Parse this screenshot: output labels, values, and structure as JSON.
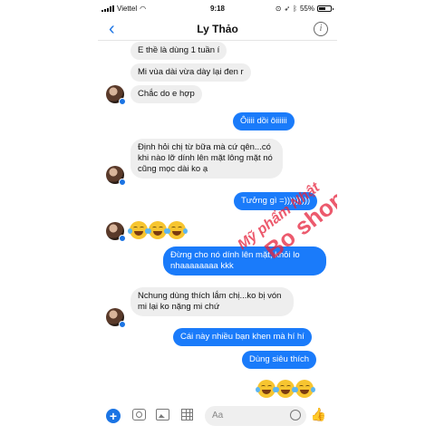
{
  "status_bar": {
    "carrier": "Viettel",
    "time": "9:18",
    "battery": "55%",
    "battery_level": 0.55
  },
  "header": {
    "title": "Ly Thảo",
    "back_icon": "chevron-left-icon",
    "info_icon": "info-icon"
  },
  "messages": [
    {
      "dir": "in",
      "text": "E thề là dùng 1 tuần í"
    },
    {
      "dir": "in",
      "text": "Mi vùa dài vừa dày lại đen r"
    },
    {
      "dir": "in",
      "text": "Chắc do e hợp"
    },
    {
      "dir": "out",
      "text": "Ôiiii dồi ôiiiiii"
    },
    {
      "dir": "in",
      "text": "Định hỏi chị từ bữa mà cứ qên...có khi nào lỡ dính lên mặt lông mặt nó cũng mọc dài ko ạ"
    },
    {
      "dir": "out",
      "text": "Tưởng gì =)))))))))"
    },
    {
      "dir": "out",
      "text": "Đừng cho nó dính lên mặt, khỏi lo nhaaaaaaaa kkk"
    },
    {
      "dir": "in",
      "text": "Nchung dùng thích lắm chị...ko bị vón mi lại ko nặng mi chứ"
    },
    {
      "dir": "out",
      "text": "Cái này nhiều bạn khen mà hí hí"
    },
    {
      "dir": "out",
      "text": "Dùng siêu thích"
    }
  ],
  "watermark": {
    "line1": "Mỹ phẩm Nhật",
    "line2": "Bo shop"
  },
  "composer": {
    "placeholder": "Aa",
    "add_icon": "plus-icon",
    "like_icon": "thumbs-up-icon"
  }
}
